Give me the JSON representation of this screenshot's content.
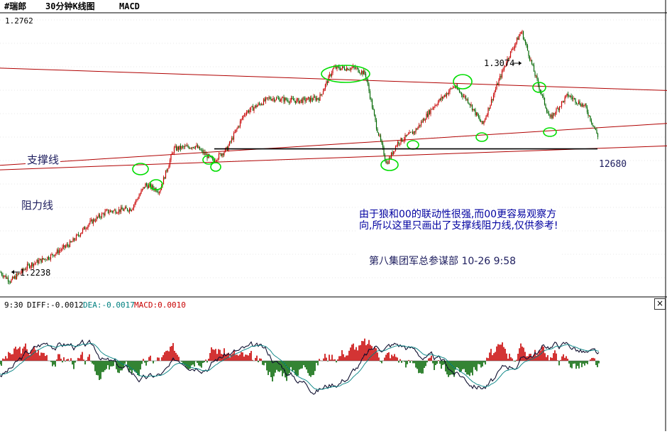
{
  "header": {
    "symbol": "#瑞郎",
    "period": "30分钟K线图",
    "indicator": "MACD"
  },
  "price_top_label": "1.2762",
  "annotations": {
    "support_line_label": "支撑线",
    "resistance_line_label": "阻力线",
    "high_label": "1.3074",
    "low_label": "1.2238",
    "level_label": "12680",
    "note_text": "由于狼和00的联动性很强,而00更容易观察方向,所以这里只画出了支撑线阻力线,仅供参考!",
    "signature": "第八集团军总参谋部 10-26 9:58"
  },
  "macd_header": {
    "time": "9:30",
    "diff_label": "DIFF:-0.0012",
    "dea_label": "DEA:-0.0017",
    "macd_label": "MACD:0.0010"
  },
  "colors": {
    "up": "#c80000",
    "down": "#006600",
    "trend_line": "#b00000",
    "dea": "#008080",
    "note_text": "#0000a0",
    "highlight_circle": "#00dd00"
  },
  "chart_data": {
    "type": "candlestick",
    "title": "#瑞郎 30分钟K线图 MACD",
    "ylim": [
      1.219,
      1.313
    ],
    "price_path": [
      [
        0,
        1.2268
      ],
      [
        15,
        1.2238
      ],
      [
        40,
        1.229
      ],
      [
        70,
        1.232
      ],
      [
        100,
        1.2365
      ],
      [
        125,
        1.243
      ],
      [
        150,
        1.247
      ],
      [
        185,
        1.248
      ],
      [
        205,
        1.256
      ],
      [
        225,
        1.254
      ],
      [
        245,
        1.268
      ],
      [
        275,
        1.269
      ],
      [
        300,
        1.264
      ],
      [
        320,
        1.268
      ],
      [
        345,
        1.28
      ],
      [
        380,
        1.285
      ],
      [
        420,
        1.284
      ],
      [
        450,
        1.285
      ],
      [
        470,
        1.295
      ],
      [
        500,
        1.295
      ],
      [
        515,
        1.293
      ],
      [
        530,
        1.276
      ],
      [
        545,
        1.263
      ],
      [
        560,
        1.27
      ],
      [
        585,
        1.274
      ],
      [
        610,
        1.282
      ],
      [
        640,
        1.289
      ],
      [
        660,
        1.284
      ],
      [
        680,
        1.276
      ],
      [
        700,
        1.289
      ],
      [
        715,
        1.298
      ],
      [
        735,
        1.3074
      ],
      [
        755,
        1.292
      ],
      [
        775,
        1.278
      ],
      [
        800,
        1.286
      ],
      [
        825,
        1.282
      ],
      [
        843,
        1.272
      ]
    ],
    "support_line": {
      "from": [
        0,
        1.261
      ],
      "to": [
        940,
        1.269
      ]
    },
    "upper_support_line": {
      "from": [
        0,
        1.2625
      ],
      "to": [
        940,
        1.2765
      ]
    },
    "resistance_line": {
      "from": [
        0,
        1.295
      ],
      "to": [
        940,
        1.2875
      ]
    },
    "horizontal_level": 1.268,
    "macd": {
      "diff": -0.0012,
      "dea": -0.0017,
      "macd": 0.001
    }
  }
}
